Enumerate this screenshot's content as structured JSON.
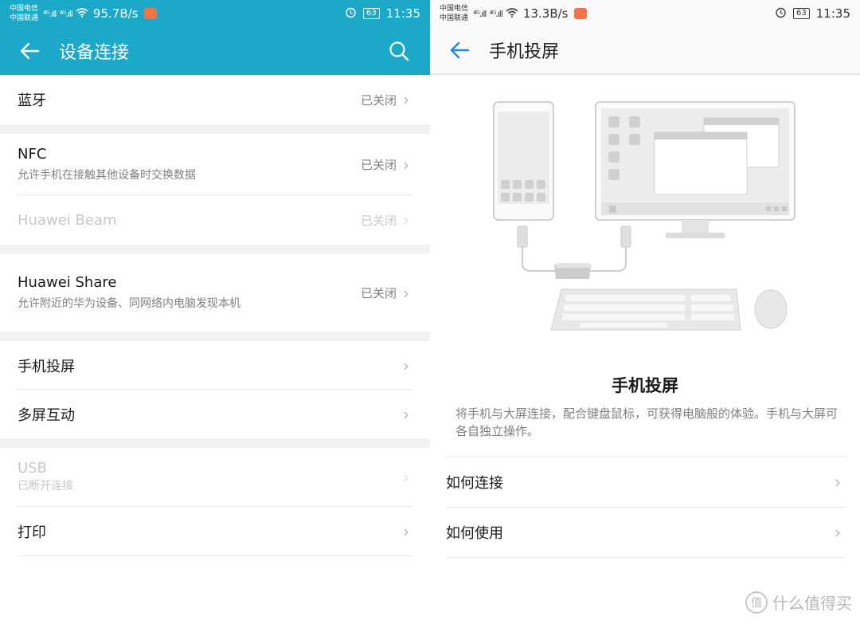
{
  "left": {
    "status": {
      "carrier1": "中国电信",
      "carrier2": "中国联通",
      "signal1": "⁴ᴳ.ıll",
      "signal2": "⁴ᴳ.ıll",
      "speed": "95.7B/s",
      "battery": "63",
      "time": "11:35"
    },
    "toolbar": {
      "title": "设备连接"
    },
    "items": [
      {
        "title": "蓝牙",
        "value": "已关闭"
      },
      {
        "title": "NFC",
        "subtitle": "允许手机在接触其他设备时交换数据",
        "value": "已关闭"
      },
      {
        "title": "Huawei Beam",
        "value": "已关闭"
      },
      {
        "title": "Huawei Share",
        "subtitle": "允许附近的华为设备、同网络内电脑发现本机",
        "value": "已关闭"
      },
      {
        "title": "手机投屏"
      },
      {
        "title": "多屏互动"
      },
      {
        "title": "USB",
        "subtitle": "已断开连接"
      },
      {
        "title": "打印"
      }
    ]
  },
  "right": {
    "status": {
      "carrier1": "中国电信",
      "carrier2": "中国联通",
      "signal1": "⁴ᴳ.ıll",
      "signal2": "⁴ᴳ.ıll",
      "speed": "13.3B/s",
      "battery": "63",
      "time": "11:35"
    },
    "toolbar": {
      "title": "手机投屏"
    },
    "heading": "手机投屏",
    "description": "将手机与大屏连接，配合键盘鼠标，可获得电脑般的体验。手机与大屏可各自独立操作。",
    "links": [
      {
        "label": "如何连接"
      },
      {
        "label": "如何使用"
      }
    ]
  },
  "chevron": "›",
  "watermark": {
    "logo": "值",
    "text": "什么值得买"
  },
  "colors": {
    "accent": "#1ca9c9",
    "back_icon_right": "#1e88e5"
  }
}
